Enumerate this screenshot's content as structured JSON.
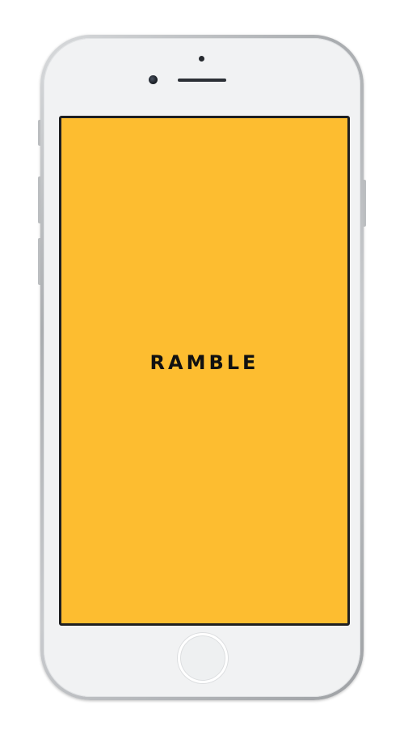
{
  "app": {
    "title": "RAMBLE",
    "brand_color": "#fdbd30",
    "title_color": "#111111"
  },
  "device": {
    "frame_color": "#f1f2f3",
    "icons": [
      "front-camera-icon",
      "proximity-sensor-icon",
      "earpiece-speaker-icon",
      "home-button-icon"
    ]
  }
}
